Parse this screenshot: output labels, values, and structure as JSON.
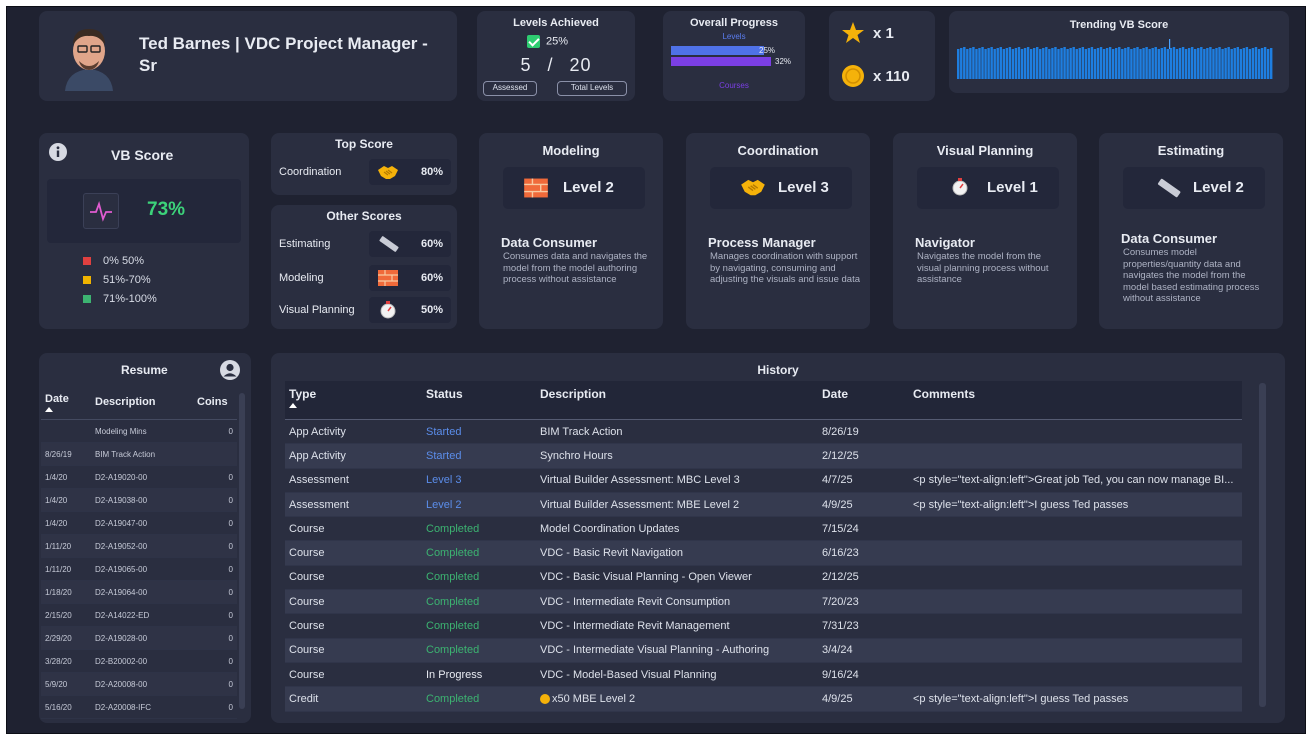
{
  "profile": {
    "name": "Ted Barnes  |  VDC Project Manager - Sr"
  },
  "levels_achieved": {
    "title": "Levels Achieved",
    "percent": "25%",
    "achieved": "5",
    "separator": "/",
    "total": "20",
    "assessed_label": "Assessed",
    "total_label": "Total Levels"
  },
  "overall_progress": {
    "title": "Overall Progress",
    "levels_label": "Levels",
    "levels_value": "25%",
    "levels_fraction": 0.25,
    "courses_value": "32%",
    "courses_fraction": 0.32,
    "courses_label": "Courses"
  },
  "rewards": {
    "stars": "x  1",
    "coins": "x  110"
  },
  "trending": {
    "title": "Trending VB Score"
  },
  "vb_score": {
    "title": "VB Score",
    "value": "73%",
    "legend": [
      "0% 50%",
      "51%-70%",
      "71%-100%"
    ],
    "legend_colors": [
      "#e04040",
      "#f0b400",
      "#3cb371"
    ]
  },
  "top_score": {
    "title": "Top Score",
    "label": "Coordination",
    "value": "80%"
  },
  "other_scores": {
    "title": "Other Scores",
    "items": [
      {
        "label": "Estimating",
        "value": "60%"
      },
      {
        "label": "Modeling",
        "value": "60%"
      },
      {
        "label": "Visual Planning",
        "value": "50%"
      }
    ]
  },
  "level_cards": [
    {
      "title": "Modeling",
      "level": "Level 2",
      "role": "Data Consumer",
      "desc": "Consumes data and navigates the model from the model authoring process without assistance"
    },
    {
      "title": "Coordination",
      "level": "Level 3",
      "role": "Process Manager",
      "desc": "Manages coordination with support by navigating, consuming and adjusting the visuals and issue data"
    },
    {
      "title": "Visual Planning",
      "level": "Level 1",
      "role": "Navigator",
      "desc": "Navigates the model from the visual planning process without assistance"
    },
    {
      "title": "Estimating",
      "level": "Level 2",
      "role": "Data Consumer",
      "desc": "Consumes model properties/quantity data and navigates the model from the model based estimating process without assistance"
    }
  ],
  "resume": {
    "title": "Resume",
    "columns": [
      "Date",
      "Description",
      "Coins"
    ],
    "rows": [
      [
        "",
        "Modeling Mins",
        "0"
      ],
      [
        "8/26/19",
        "BIM Track Action",
        ""
      ],
      [
        "1/4/20",
        "D2-A19020-00",
        "0"
      ],
      [
        "1/4/20",
        "D2-A19038-00",
        "0"
      ],
      [
        "1/4/20",
        "D2-A19047-00",
        "0"
      ],
      [
        "1/11/20",
        "D2-A19052-00",
        "0"
      ],
      [
        "1/11/20",
        "D2-A19065-00",
        "0"
      ],
      [
        "1/18/20",
        "D2-A19064-00",
        "0"
      ],
      [
        "2/15/20",
        "D2-A14022-ED",
        "0"
      ],
      [
        "2/29/20",
        "D2-A19028-00",
        "0"
      ],
      [
        "3/28/20",
        "D2-B20002-00",
        "0"
      ],
      [
        "5/9/20",
        "D2-A20008-00",
        "0"
      ],
      [
        "5/16/20",
        "D2-A20008-IFC",
        "0"
      ]
    ]
  },
  "history": {
    "title": "History",
    "columns": [
      "Type",
      "Status",
      "Description",
      "Date",
      "Comments"
    ],
    "rows": [
      {
        "type": "App Activity",
        "status": "Started",
        "status_kind": "blue",
        "desc": "BIM Track Action",
        "date": "8/26/19",
        "comments": ""
      },
      {
        "type": "App Activity",
        "status": "Started",
        "status_kind": "blue",
        "desc": "Synchro Hours",
        "date": "2/12/25",
        "comments": ""
      },
      {
        "type": "Assessment",
        "status": "Level 3",
        "status_kind": "blue",
        "desc": "Virtual Builder Assessment: MBC Level 3",
        "date": "4/7/25",
        "comments": "<p style=\"text-align:left\">Great job Ted, you can now manage BI..."
      },
      {
        "type": "Assessment",
        "status": "Level 2",
        "status_kind": "blue",
        "desc": "Virtual Builder Assessment: MBE Level 2",
        "date": "4/9/25",
        "comments": "<p style=\"text-align:left\">I guess Ted passes"
      },
      {
        "type": "Course",
        "status": "Completed",
        "status_kind": "green",
        "desc": "Model Coordination Updates",
        "date": "7/15/24",
        "comments": ""
      },
      {
        "type": "Course",
        "status": "Completed",
        "status_kind": "green",
        "desc": "VDC - Basic Revit Navigation",
        "date": "6/16/23",
        "comments": ""
      },
      {
        "type": "Course",
        "status": "Completed",
        "status_kind": "green",
        "desc": "VDC - Basic Visual Planning - Open Viewer",
        "date": "2/12/25",
        "comments": ""
      },
      {
        "type": "Course",
        "status": "Completed",
        "status_kind": "green",
        "desc": "VDC - Intermediate Revit Consumption",
        "date": "7/20/23",
        "comments": ""
      },
      {
        "type": "Course",
        "status": "Completed",
        "status_kind": "green",
        "desc": "VDC - Intermediate Revit Management",
        "date": "7/31/23",
        "comments": ""
      },
      {
        "type": "Course",
        "status": "Completed",
        "status_kind": "green",
        "desc": "VDC - Intermediate Visual Planning - Authoring",
        "date": "3/4/24",
        "comments": ""
      },
      {
        "type": "Course",
        "status": "In Progress",
        "status_kind": "white",
        "desc": "VDC - Model-Based Visual Planning",
        "date": "9/16/24",
        "comments": ""
      },
      {
        "type": "Credit",
        "status": "Completed",
        "status_kind": "green",
        "desc": "x50 MBE Level 2",
        "date": "4/9/25",
        "comments": "<p style=\"text-align:left\">I guess Ted passes",
        "coin": true
      }
    ]
  }
}
